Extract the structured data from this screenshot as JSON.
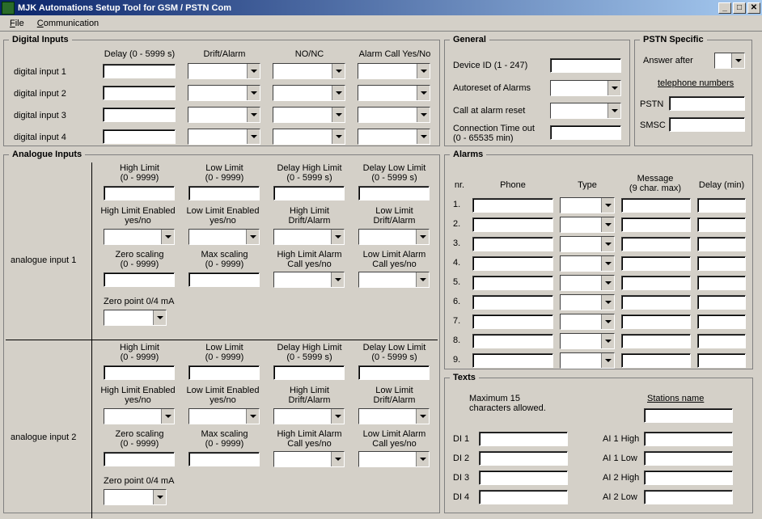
{
  "window": {
    "title": "MJK Automations Setup Tool for GSM / PSTN Com"
  },
  "menu": {
    "file": "File",
    "communication": "Communication"
  },
  "digitalInputs": {
    "legend": "Digital Inputs",
    "headers": {
      "delay": "Delay (0 - 5999 s)",
      "drift": "Drift/Alarm",
      "nonc": "NO/NC",
      "call": "Alarm Call Yes/No"
    },
    "rows": [
      "digital input 1",
      "digital input 2",
      "digital input 3",
      "digital input 4"
    ]
  },
  "general": {
    "legend": "General",
    "deviceId": "Device ID (1 - 247)",
    "autoreset": "Autoreset of Alarms",
    "callAtAlarm": "Call at alarm reset",
    "connTimeout": "Connection Time out\n(0 - 65535 min)"
  },
  "pstn": {
    "legend": "PSTN Specific",
    "answerAfter": "Answer after",
    "telNumbers": "telephone numbers",
    "pstnLbl": "PSTN",
    "smscLbl": "SMSC"
  },
  "analogue": {
    "legend": "Analogue Inputs",
    "row1": "analogue input 1",
    "row2": "analogue input 2",
    "hl": "High Limit\n(0 - 9999)",
    "ll": "Low Limit\n(0 - 9999)",
    "dhl": "Delay High Limit\n(0 - 5999 s)",
    "dll": "Delay Low Limit\n(0 - 5999 s)",
    "hle": "High Limit Enabled\nyes/no",
    "lle": "Low Limit Enabled\nyes/no",
    "hlda": "High Limit\nDrift/Alarm",
    "llda": "Low Limit\nDrift/Alarm",
    "zs": "Zero scaling\n(0 - 9999)",
    "ms": "Max scaling\n(0 - 9999)",
    "hlac": "High Limit Alarm\nCall yes/no",
    "llac": "Low Limit Alarm\nCall yes/no",
    "zp": "Zero point 0/4 mA"
  },
  "alarms": {
    "legend": "Alarms",
    "nr": "nr.",
    "phone": "Phone",
    "type": "Type",
    "message": "Message\n(9 char. max)",
    "delay": "Delay (min)",
    "rows": [
      "1.",
      "2.",
      "3.",
      "4.",
      "5.",
      "6.",
      "7.",
      "8.",
      "9."
    ]
  },
  "texts": {
    "legend": "Texts",
    "maxChars": "Maximum 15\ncharacters allowed.",
    "stationsName": "Stations name",
    "di": [
      "DI 1",
      "DI 2",
      "DI 3",
      "DI 4"
    ],
    "ai": [
      "AI 1 High",
      "AI 1 Low",
      "AI 2 High",
      "AI 2 Low"
    ]
  }
}
